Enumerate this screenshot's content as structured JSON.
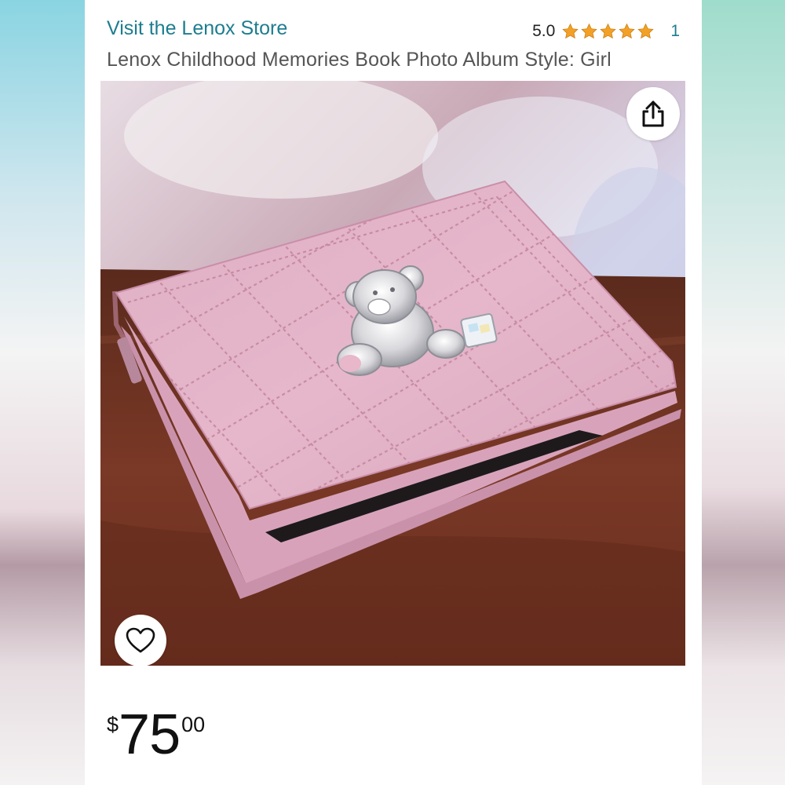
{
  "store": {
    "link_text": "Visit the Lenox Store"
  },
  "rating": {
    "value": "5.0",
    "stars": 5,
    "count": "1"
  },
  "product": {
    "title": "Lenox Childhood Memories Book Photo Album Style: Girl"
  },
  "price": {
    "symbol": "$",
    "whole": "75",
    "fraction": "00"
  },
  "icons": {
    "share": "share-icon",
    "favorite": "heart-icon",
    "star": "star-icon"
  },
  "colors": {
    "link": "#1d7d8f",
    "star": "#f3a126",
    "album_pink": "#e4b2c7"
  }
}
